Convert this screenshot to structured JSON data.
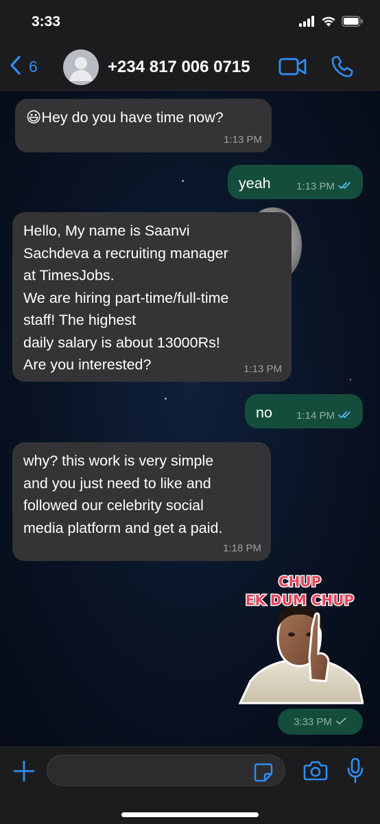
{
  "status_bar": {
    "time": "3:33",
    "icons": [
      "cellular-signal-icon",
      "wifi-icon",
      "battery-icon"
    ]
  },
  "header": {
    "back_count": "6",
    "contact": "+234 817 006 0715",
    "icons": [
      "chevron-left-icon",
      "avatar-icon",
      "video-call-icon",
      "phone-icon"
    ]
  },
  "messages": [
    {
      "direction": "incoming",
      "emoji": "😃",
      "text": "Hey do you have time now?",
      "time": "1:13 PM"
    },
    {
      "direction": "outgoing",
      "text": "yeah",
      "time": "1:13 PM",
      "status": "read"
    },
    {
      "direction": "incoming",
      "text": "Hello, My name is Saanvi\nSachdeva a recruiting manager\nat TimesJobs.\nWe are hiring part-time/full-time\nstaff! The highest\ndaily salary is about 13000Rs!\nAre you interested?",
      "time": "1:13 PM"
    },
    {
      "direction": "outgoing",
      "text": "no",
      "time": "1:14 PM",
      "status": "read"
    },
    {
      "direction": "incoming",
      "text": "why? this work is very simple\nand you just need to like and\nfollowed our celebrity social\nmedia platform and get a paid.",
      "time": "1:18 PM"
    }
  ],
  "sticker": {
    "line1": "CHUP",
    "line2": "EK DUM CHUP",
    "time": "3:33 PM",
    "status": "delivered"
  },
  "composer": {
    "placeholder": "",
    "icons": [
      "plus-icon",
      "sticker-icon",
      "camera-icon",
      "microphone-icon"
    ]
  },
  "colors": {
    "accent": "#2f8ef2",
    "incoming_bubble": "#343436",
    "outgoing_bubble": "#144d3b",
    "read_ticks": "#53bdeb",
    "bar_background": "#1c1c1e"
  }
}
